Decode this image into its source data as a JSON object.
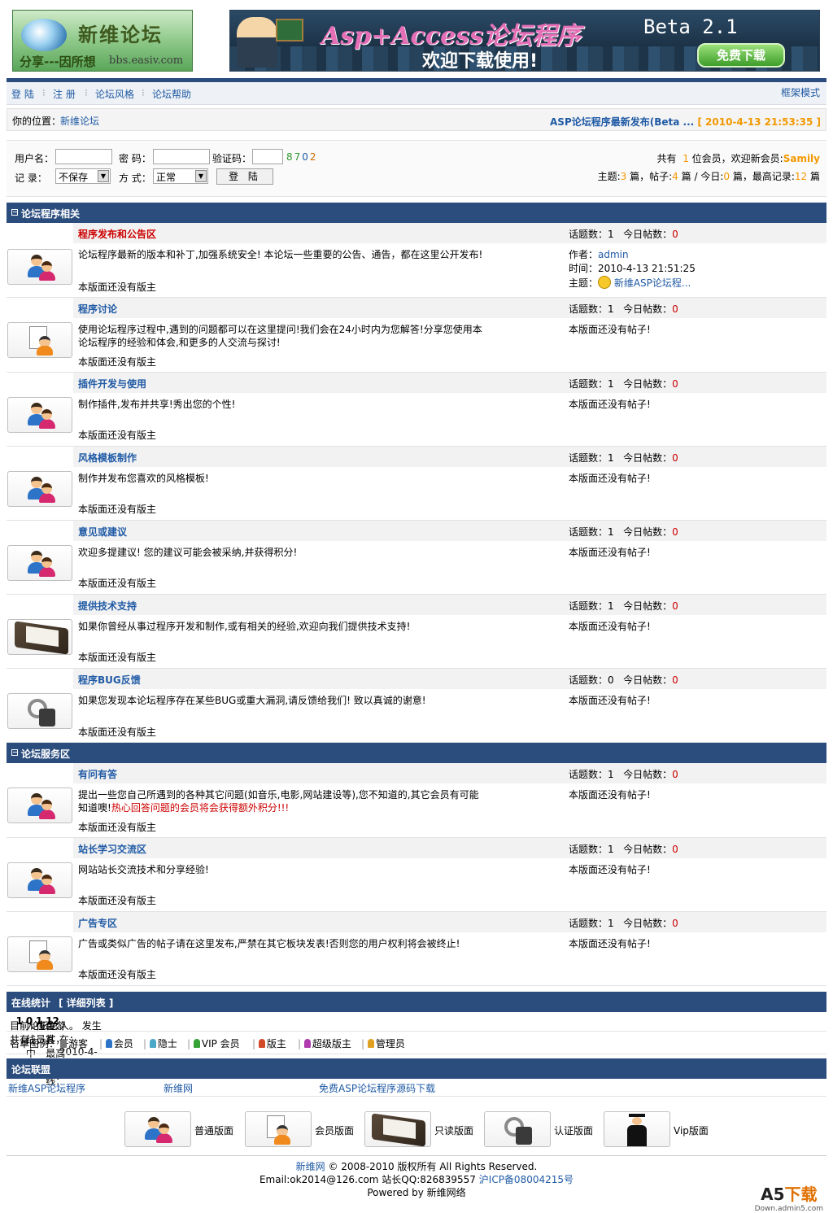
{
  "header": {
    "logo_name": "新维论坛",
    "logo_slogan": "分享---因所想",
    "logo_domain": "bbs.easiv.com",
    "banner_title": "Asp+Access论坛程序",
    "banner_sub": "欢迎下载使用!",
    "banner_beta": "Beta 2.1",
    "banner_download": "免费下载"
  },
  "nav": {
    "login": "登 陆",
    "register": "注 册",
    "style": "论坛风格",
    "help": "论坛帮助",
    "frame": "框架模式"
  },
  "location": {
    "prefix": "你的位置：",
    "site": "新维论坛",
    "news": "ASP论坛程序最新发布(Beta ...",
    "news_time": "[ 2010-4-13 21:53:35 ]"
  },
  "login": {
    "user_label": "用户名：",
    "pass_label": "密  码：",
    "code_label": "验证码：",
    "code_digits": [
      "8",
      "7",
      "0",
      "2"
    ],
    "remember_label": "记  录：",
    "remember_value": "不保存",
    "mode_label": "方  式：",
    "mode_value": "正常",
    "submit": "登 陆"
  },
  "stats": {
    "total_pre": "共有",
    "members": "1",
    "total_mid": "位会员，欢迎新会员:",
    "newest": "Samily",
    "topics_label": "主题:",
    "topics": "3",
    "posts_label": "篇，帖子:",
    "posts": "4",
    "today_label": "篇 / 今日:",
    "today": "0",
    "record_label": "篇，最高记录:",
    "record": "12",
    "unit": "篇"
  },
  "sections": [
    {
      "title": "论坛程序相关"
    },
    {
      "title": "论坛服务区"
    }
  ],
  "labels": {
    "topics": "话题数：",
    "today": "今日帖数：",
    "no_mod": "本版面还没有版主",
    "no_post": "本版面还没有帖子!",
    "author": "作者：",
    "time": "时间：",
    "subject": "主题："
  },
  "forums": [
    {
      "name": "程序发布和公告区",
      "desc": "论坛程序最新的版本和补丁,加强系统安全! 本论坛一些重要的公告、通告，都在这里公开发布!",
      "topics": "1",
      "today": "0",
      "author": "admin",
      "time": "2010-4-13 21:51:25",
      "subject": "新维ASP论坛程..."
    },
    {
      "name": "程序讨论",
      "desc": "使用论坛程序过程中,遇到的问题都可以在这里提问!我们会在24小时内为您解答!分享您使用本论坛程序的经验和体会,和更多的人交流与探讨!",
      "topics": "1",
      "today": "0"
    },
    {
      "name": "插件开发与使用",
      "desc": "制作插件,发布并共享!秀出您的个性!",
      "topics": "1",
      "today": "0"
    },
    {
      "name": "风格模板制作",
      "desc": "制作并发布您喜欢的风格模板!",
      "topics": "1",
      "today": "0"
    },
    {
      "name": "意见或建议",
      "desc": "欢迎多提建议! 您的建议可能会被采纳,并获得积分!",
      "topics": "1",
      "today": "0"
    },
    {
      "name": "提供技术支持",
      "desc": "如果你曾经从事过程序开发和制作,或有相关的经验,欢迎向我们提供技术支持!",
      "topics": "1",
      "today": "0"
    },
    {
      "name": "程序BUG反馈",
      "desc": "如果您发现本论坛程序存在某些BUG或重大漏洞,请反馈给我们! 致以真诚的谢意!",
      "topics": "0",
      "today": "0"
    },
    {
      "name": "有问有答",
      "desc": "提出一些您自己所遇到的各种其它问题(如音乐,电影,网站建设等),您不知道的,其它会员有可能知道噢!",
      "desc_red": "热心回答问题的会员将会获得额外积分!!!",
      "topics": "1",
      "today": "0"
    },
    {
      "name": "站长学习交流区",
      "desc": "网站站长交流技术和分享经验!",
      "topics": "1",
      "today": "0"
    },
    {
      "name": "广告专区",
      "desc": "广告或类似广告的帖子请在这里发布,严禁在其它板块发表!否则您的用户权利将会被终止!",
      "topics": "1",
      "today": "0"
    }
  ],
  "online": {
    "title": "在线统计",
    "detail": "[ 详细列表 ]",
    "line_pre": "目前论坛总共有",
    "online": "1",
    "t1": "人在线，其中",
    "members": "0",
    "t2": "位会员，",
    "guests": "1",
    "t3": "位游客，最高峰在线：",
    "peak": "12",
    "t4": "人。 发生在：2010-4-13 21:08:14",
    "legend_label": "名单图例：",
    "legend": [
      "游客",
      "会员",
      "隐士",
      "VIP 会员",
      "版主",
      "超级版主",
      "管理员"
    ],
    "legend_colors": [
      "#777777",
      "#2d74c9",
      "#4aa8c8",
      "#35a335",
      "#d34a2a",
      "#b03ab0",
      "#e0a020"
    ]
  },
  "alliance": {
    "title": "论坛联盟",
    "links": [
      "新维ASP论坛程序",
      "新维网",
      "免费ASP论坛程序源码下载"
    ]
  },
  "legend_icons": [
    "普通版面",
    "会员版面",
    "只读版面",
    "认证版面",
    "Vip版面"
  ],
  "footer": {
    "line1_link": "新维网",
    "line1": "© 2008-2010 版权所有 All Rights Reserved.",
    "line2": "Email:ok2014@126.com 站长QQ:826839557",
    "line2_link": "沪ICP备08004215号",
    "line3": "Powered by 新维网络"
  },
  "watermark": {
    "big1": "A5",
    "big2": "下载",
    "small": "Down.admin5.com"
  },
  "colors": {
    "header_bar": "#2b4d7e",
    "link": "#1f5aa5",
    "accent_red": "#cc0000",
    "accent_orange": "#f39800"
  }
}
